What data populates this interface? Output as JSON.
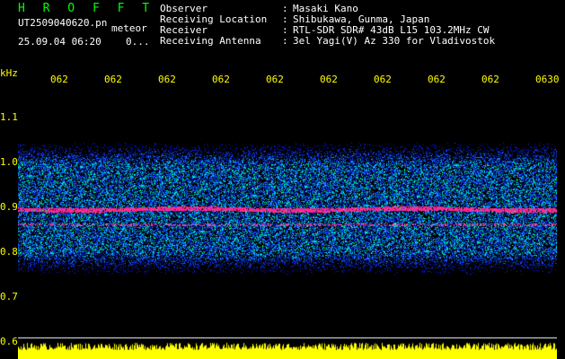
{
  "header": {
    "title": "H R O F F T",
    "filename": "UT2509040620.pn",
    "type": "meteor",
    "datetime": "25.09.04 06:20",
    "counter": "0..."
  },
  "info": [
    {
      "label": "Observer",
      "value": "Masaki Kano"
    },
    {
      "label": "Receiving Location",
      "value": "Shibukawa, Gunma, Japan"
    },
    {
      "label": "Receiver",
      "value": "RTL-SDR SDR# 43dB L15 103.2MHz CW"
    },
    {
      "label": "Receiving Antenna",
      "value": "3el Yagi(V) Az 330 for Vladivostok"
    }
  ],
  "axis": {
    "unit": "kHz",
    "time_ticks": [
      "062",
      "062",
      "062",
      "062",
      "062",
      "062",
      "062",
      "062",
      "062",
      "0630"
    ],
    "freq_ticks": [
      "1.1",
      "1.0",
      "0.9",
      "0.8",
      "0.7",
      "0.6"
    ]
  },
  "colors": {
    "background": "#000000",
    "title": "#00ff00",
    "text": "#ffffff",
    "axis": "#ffff00",
    "signal_strong": "#ff2a8a",
    "signal_mid": "#00ff80",
    "noise_low": "#1030ff",
    "power_bar": "#ffff00"
  }
}
